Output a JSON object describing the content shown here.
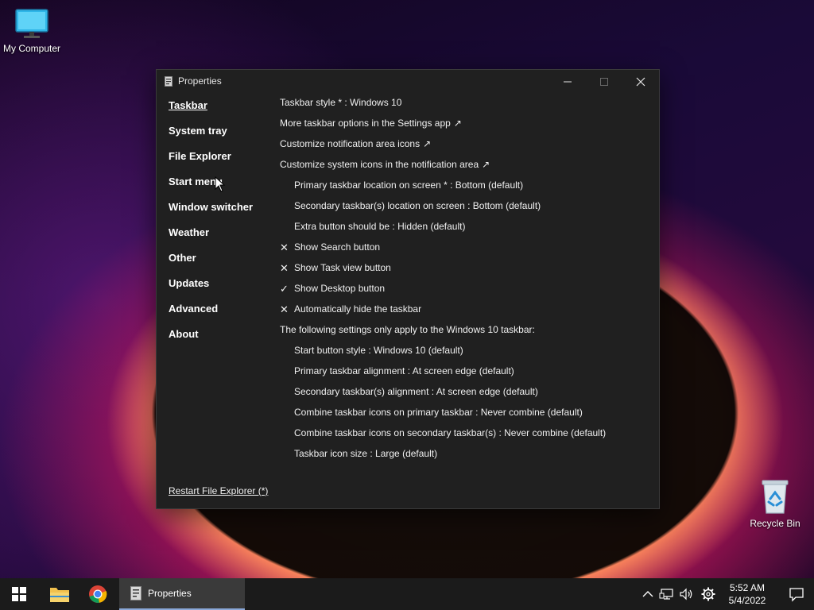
{
  "desktop": {
    "my_computer": "My Computer",
    "recycle_bin": "Recycle Bin"
  },
  "window": {
    "title": "Properties",
    "sidebar": [
      {
        "label": "Taskbar",
        "active": true
      },
      {
        "label": "System tray"
      },
      {
        "label": "File Explorer"
      },
      {
        "label": "Start menu"
      },
      {
        "label": "Window switcher"
      },
      {
        "label": "Weather"
      },
      {
        "label": "Other"
      },
      {
        "label": "Updates"
      },
      {
        "label": "Advanced"
      },
      {
        "label": "About"
      }
    ],
    "settings": [
      {
        "label": "Taskbar style * : Windows 10"
      },
      {
        "label": "More taskbar options in the Settings app",
        "arrow": "↗"
      },
      {
        "label": "Customize notification area icons",
        "arrow": "↗"
      },
      {
        "label": "Customize system icons in the notification area",
        "arrow": "↗"
      },
      {
        "label": "Primary taskbar location on screen * : Bottom (default)"
      },
      {
        "label": "Secondary taskbar(s) location on screen : Bottom (default)"
      },
      {
        "label": "Extra button should be : Hidden (default)"
      },
      {
        "label": "Show Search button",
        "mark": "✕"
      },
      {
        "label": "Show Task view button",
        "mark": "✕"
      },
      {
        "label": "Show Desktop button",
        "mark": "✓"
      },
      {
        "label": "Automatically hide the taskbar",
        "mark": "✕"
      },
      {
        "label": "The following settings only apply to the Windows 10 taskbar:"
      },
      {
        "label": "Start button style : Windows 10 (default)"
      },
      {
        "label": "Primary taskbar alignment : At screen edge (default)"
      },
      {
        "label": "Secondary taskbar(s) alignment : At screen edge (default)"
      },
      {
        "label": "Combine taskbar icons on primary taskbar : Never combine (default)"
      },
      {
        "label": "Combine taskbar icons on secondary taskbar(s) : Never combine (default)"
      },
      {
        "label": "Taskbar icon size : Large (default)"
      }
    ],
    "restart_label": "Restart File Explorer (*)"
  },
  "taskbar": {
    "task_label": "Properties",
    "time": "5:52 AM",
    "date": "5/4/2022",
    "icons": [
      "windows-start-icon",
      "folder-icon",
      "chrome-icon",
      "chevron-up-icon",
      "network-icon",
      "volume-icon",
      "gear-icon",
      "notification-icon"
    ]
  }
}
